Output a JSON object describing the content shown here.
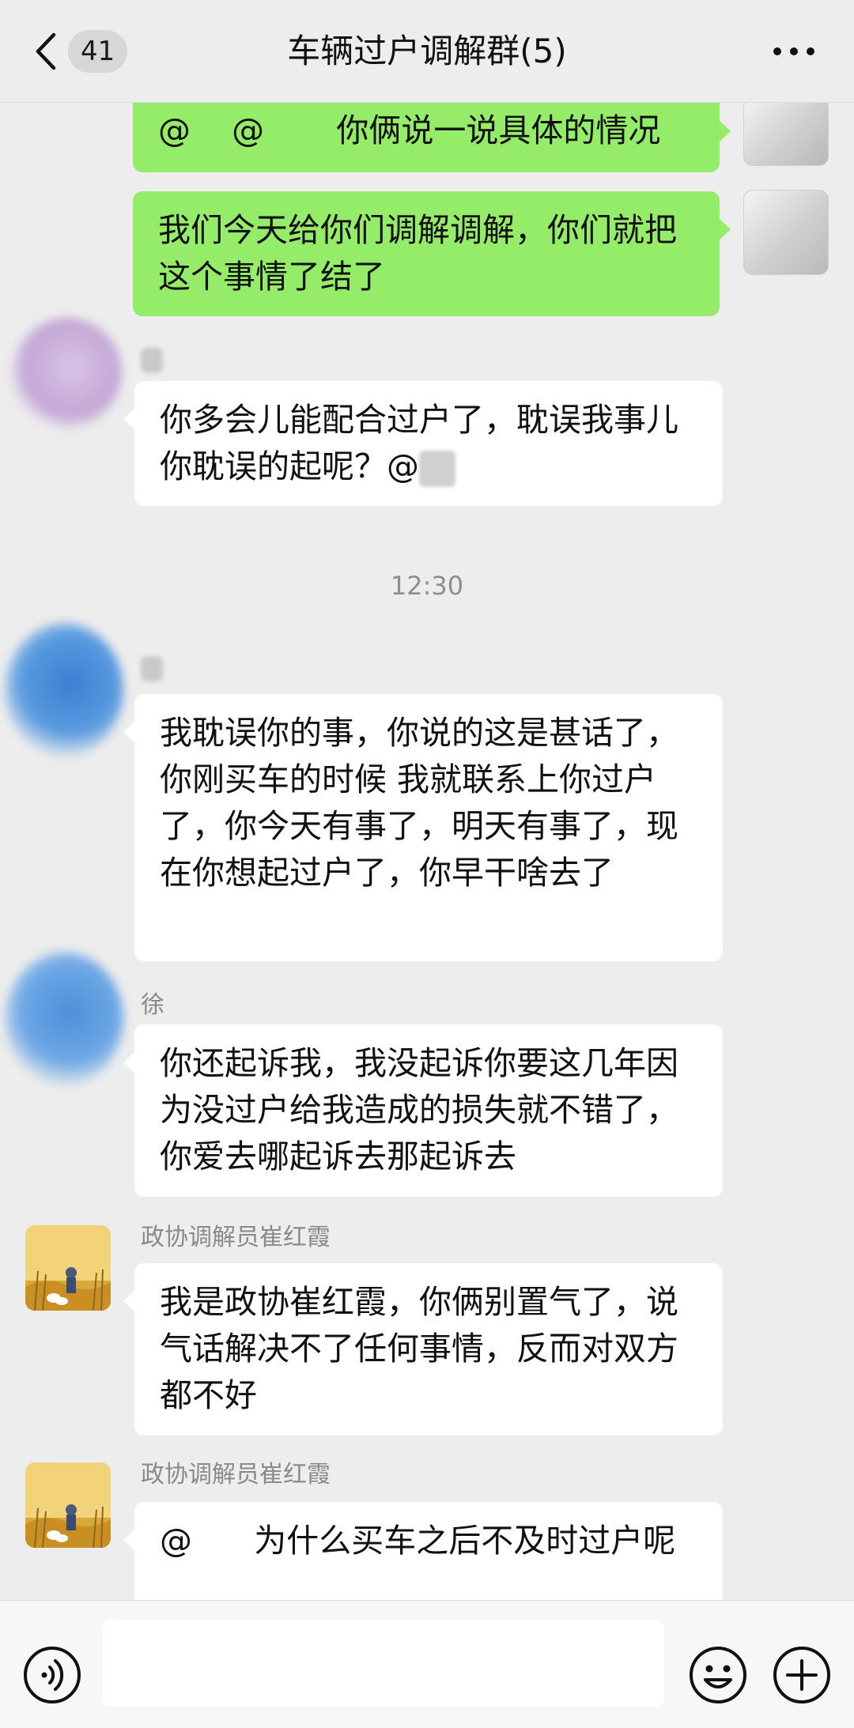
{
  "header": {
    "unread_count": "41",
    "title": "车辆过户调解群(5)"
  },
  "messages": [
    {
      "text": "@    @       你俩说一说具体的情况"
    },
    {
      "text": "我们今天给你们调解调解，你们就把这个事情了结了"
    },
    {
      "text": "你多会儿能配合过户了，耽误我事儿你耽误的起呢？@"
    },
    {
      "time": "12:30"
    },
    {
      "text": "我耽误你的事，你说的这是甚话了，你刚买车的时候 我就联系上你过户了，你今天有事了，明天有事了，现在你想起过户了，你早干啥去了"
    },
    {
      "sender": "徐",
      "text": "你还起诉我，我没起诉你要这几年因为没过户给我造成的损失就不错了，你爱去哪起诉去那起诉去"
    },
    {
      "sender": "政协调解员崔红霞",
      "text": "我是政协崔红霞，你俩别置气了，说气话解决不了任何事情，反而对双方都不好"
    },
    {
      "sender": "政协调解员崔红霞",
      "text": "@      为什么买车之后不及时过户呢"
    }
  ],
  "input": {
    "value": ""
  },
  "icons": {
    "back": "chevron-left-icon",
    "more": "more-dots-icon",
    "voice": "voice-icon",
    "emoji": "emoji-icon",
    "plus": "plus-icon"
  },
  "colors": {
    "outgoing_bubble": "#95ec69",
    "incoming_bubble": "#ffffff",
    "background": "#ededed"
  }
}
